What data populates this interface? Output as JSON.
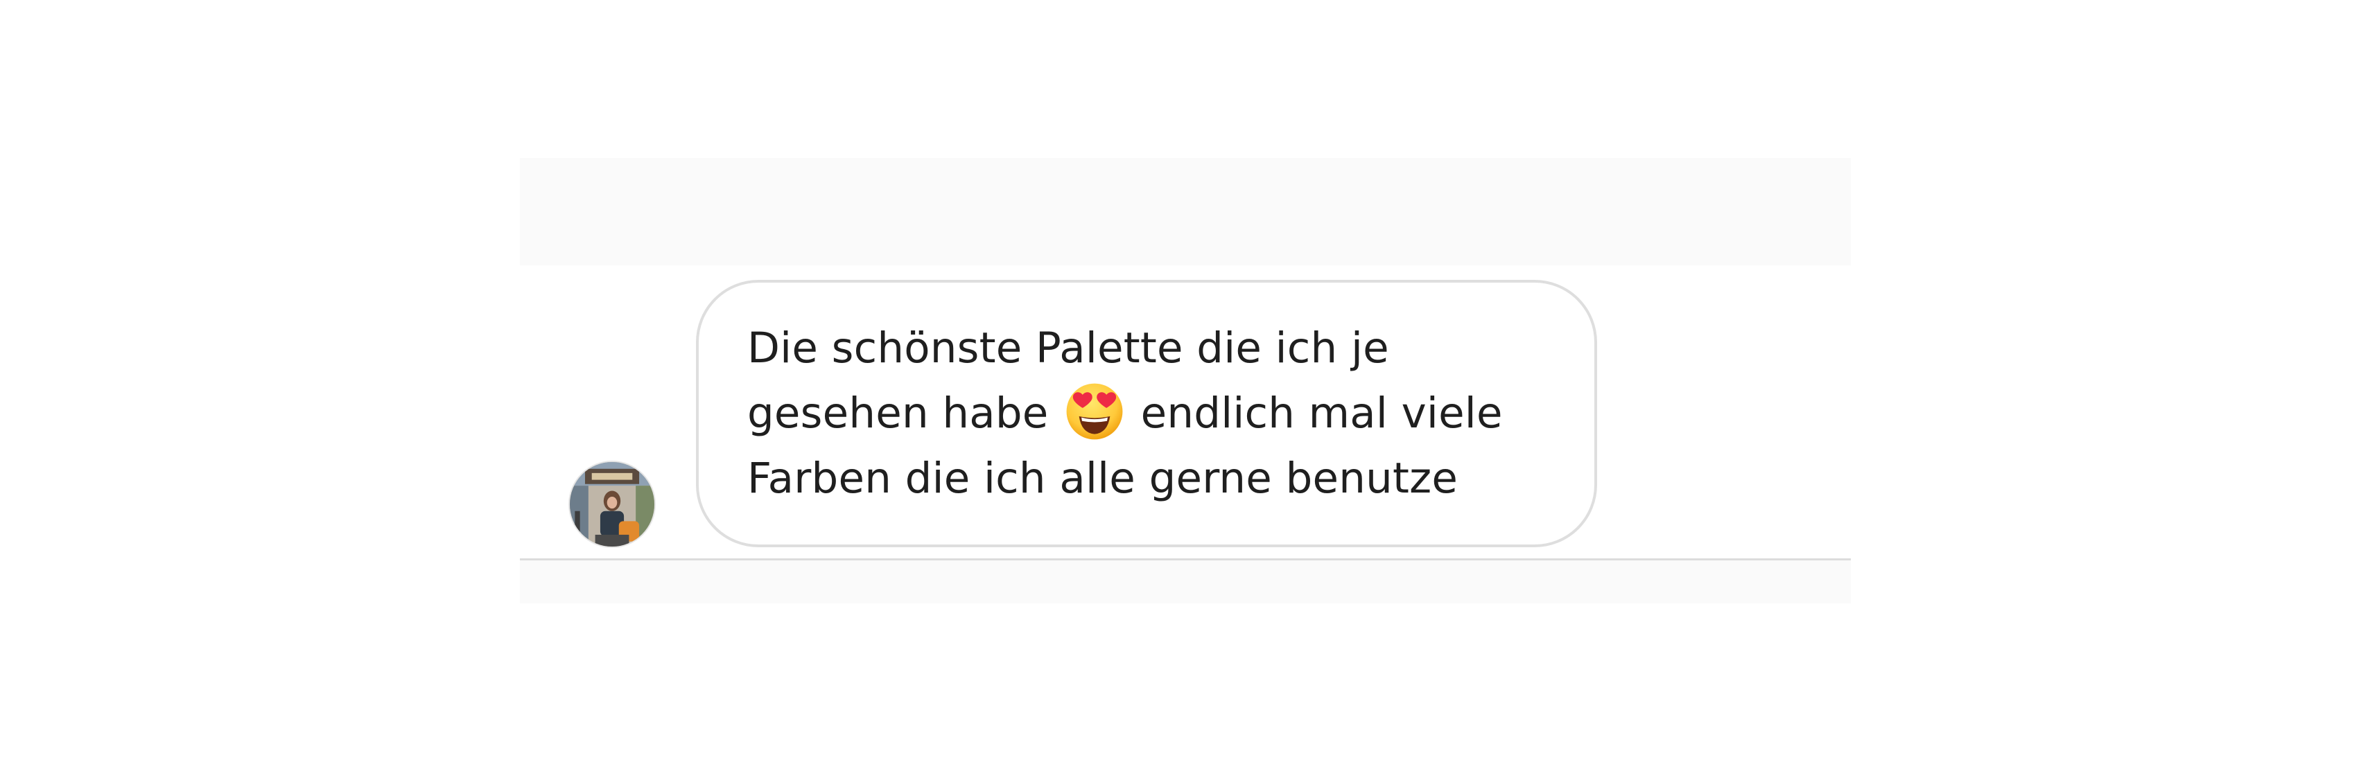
{
  "message": {
    "line1": "Die schönste Palette die ich je",
    "line2_before": "gesehen habe ",
    "line2_after": " endlich mal viele",
    "line3": "Farben die ich alle gerne benutze",
    "emoji_icon": "heart-eyes-emoji-icon"
  },
  "sender": {
    "avatar_icon": "profile-photo"
  },
  "colors": {
    "bubble_border": "#dedede",
    "panel_bg": "#fafafa",
    "text": "#1f1f1f"
  }
}
